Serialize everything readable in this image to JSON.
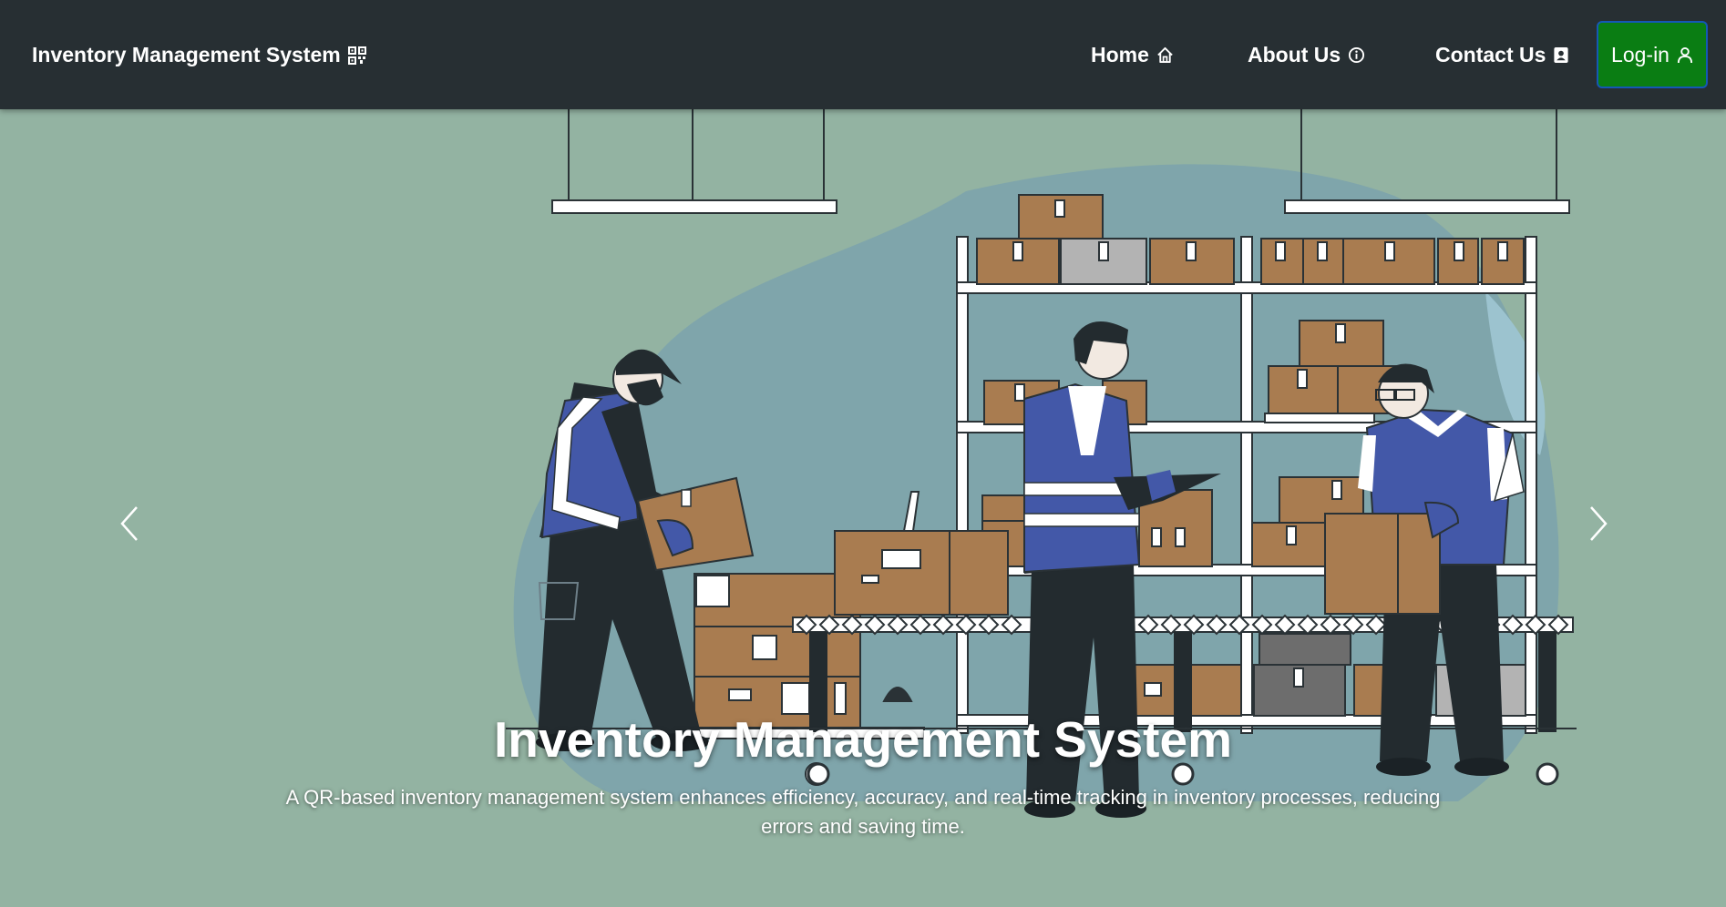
{
  "navbar": {
    "brand": "Inventory Management System",
    "links": [
      {
        "label": "Home",
        "icon": "home-icon"
      },
      {
        "label": "About Us",
        "icon": "info-icon"
      },
      {
        "label": "Contact Us",
        "icon": "contact-card-icon"
      }
    ],
    "login": {
      "label": "Log-in",
      "icon": "user-icon"
    }
  },
  "carousel": {
    "caption_title": "Inventory Management System",
    "caption_text": "A QR-based inventory management system enhances efficiency, accuracy, and real-time tracking in inventory processes, reducing errors and saving time.",
    "prev_icon": "chevron-left-icon",
    "next_icon": "chevron-right-icon"
  },
  "colors": {
    "navbar_bg": "#272f33",
    "page_bg": "#93b3a2",
    "login_bg": "#0a7d13",
    "login_border": "#1558b5",
    "vest_blue": "#4358a8",
    "box_brown": "#a97c50"
  }
}
